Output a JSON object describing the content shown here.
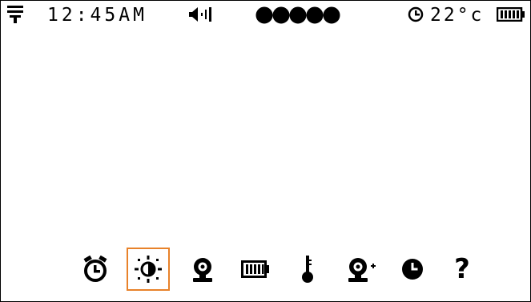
{
  "status_bar": {
    "menu_icon": "menu-lines-icon",
    "time": "12:45AM",
    "volume_icon": "speaker-volume-icon",
    "light_level": {
      "filled": 5,
      "total": 5
    },
    "clock_icon": "clock-icon",
    "temperature": "22°c",
    "battery_icon": "battery-full-icon"
  },
  "menu": {
    "selected_index": 1,
    "accent_color": "#e8822a",
    "items": [
      {
        "icon": "alarm-clock-icon"
      },
      {
        "icon": "brightness-icon"
      },
      {
        "icon": "camera-icon"
      },
      {
        "icon": "battery-icon"
      },
      {
        "icon": "thermometer-icon"
      },
      {
        "icon": "add-camera-icon"
      },
      {
        "icon": "clock-icon"
      },
      {
        "icon": "help-icon",
        "label": "?"
      }
    ]
  }
}
